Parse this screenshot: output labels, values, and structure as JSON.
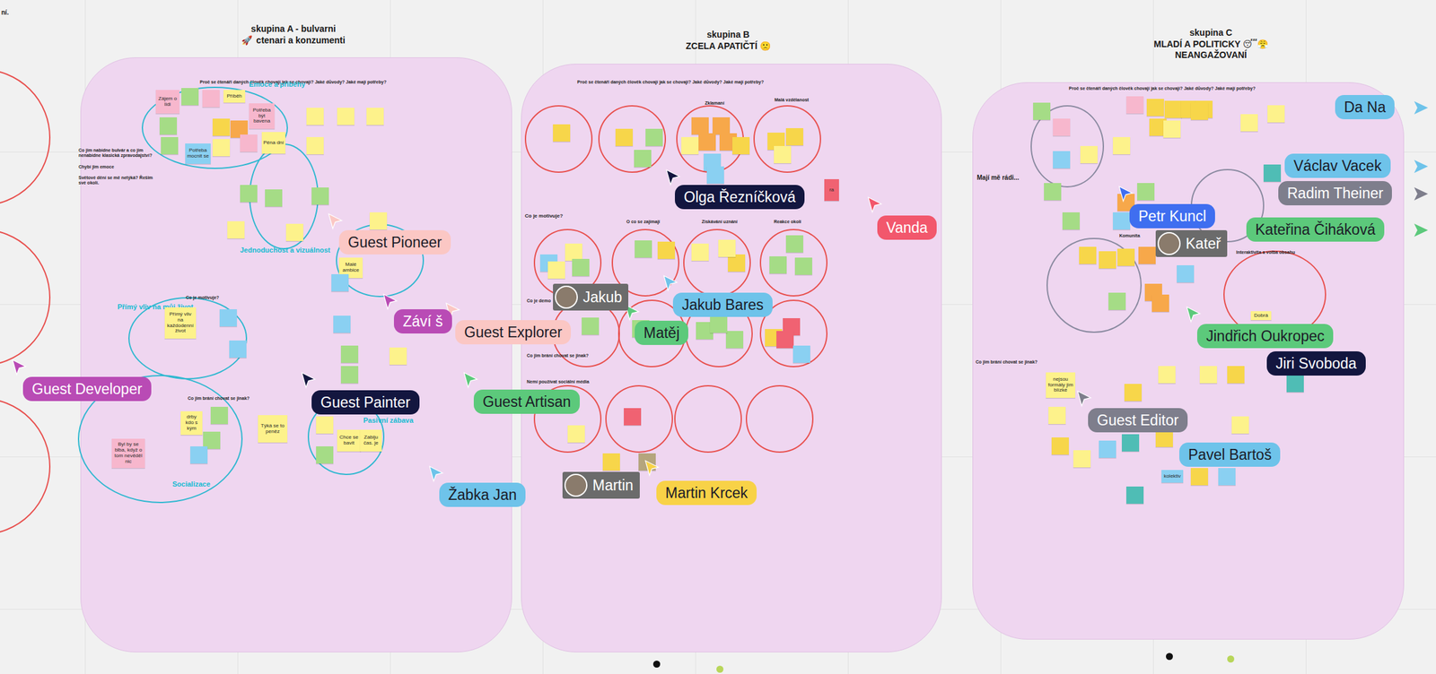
{
  "board_header": "ní.",
  "groups": [
    {
      "icon": "🚀",
      "lines": [
        "skupina A - bulvarni",
        "ctenari a konzumenti"
      ]
    },
    {
      "lines": [
        "skupina B",
        "ZCELA APATIČTÍ 🙁"
      ]
    },
    {
      "lines": [
        "skupina C",
        "MLADÍ A POLITICKY 😴😤",
        "NEANGAŽOVANÍ"
      ]
    }
  ],
  "labels": [
    "Proč se čtenáři daných člověk chovají jak se chovají? Jaké důvody? Jaké mají potřeby?",
    "Co jim nabídne bulvár a co jim nenabídne klasická zpravodajství?",
    "Chybí jim emoce",
    "Světové dění se mě netýká? Řešim své okolí.",
    "Co je motivuje?",
    "Co jim brání chovat se jinak?",
    "Proč se čtenáři daných člověk chovají jak se chovají? Jaké důvody? Jaké mají potřeby?",
    "Zklamaní",
    "Malá vzdělanost",
    "Co je motivuje?",
    "O co se zajímají",
    "Získávání uznání",
    "Reakce okolí",
    "Co je demo",
    "Co jim brání chovat se jinak?",
    "Nemí používat sociální média",
    "Proč se čtenáři daných člověk chovají jak se chovají? Jaké důvody? Jaké mají potřeby?",
    "Mají mě rádi...",
    "Komunita",
    "Interaktivita a volba obsahu",
    "Co jim brání chovat se jinak?"
  ],
  "tags": [
    "Emoce a příběhy",
    "Jednoduchost a vizuálnost",
    "Přímý vliv na můj život",
    "Socializace",
    "Pasivní zábava"
  ],
  "notes": [
    {
      "text": "Zájem o lidi",
      "color": "#f7b7cd"
    },
    {
      "text": "Příběh",
      "color": "#fdf28b"
    },
    {
      "text": "Potřeba být bavena",
      "color": "#f7b7cd"
    },
    {
      "text": "Péna dní",
      "color": "#fdf28b"
    },
    {
      "text": "Potřeba mocnit se",
      "color": "#8ad0f2"
    },
    {
      "text": "Malé ambice",
      "color": "#fdf28b"
    },
    {
      "text": "Přímý vliv na každodenní život",
      "color": "#fdf28b"
    },
    {
      "text": "Týká se to peněz",
      "color": "#fdf28b"
    },
    {
      "text": "Chce se bavit",
      "color": "#fdf28b"
    },
    {
      "text": "Zabiju čas. je",
      "color": "#fdf28b"
    },
    {
      "text": "drby kdo s kým",
      "color": "#fdf28b"
    },
    {
      "text": "Byl by se blba, když o tom nevěděl nic",
      "color": "#f7b7cd"
    },
    {
      "text": "nejsou formáty jim blízké",
      "color": "#fdf28b"
    },
    {
      "text": "Dobrá",
      "color": "#fdf28b"
    },
    {
      "text": "kolektiv",
      "color": "#8ad0f2"
    },
    {
      "text": "ra",
      "color": "#f06272"
    },
    {
      "text": "",
      "color": "#a5dc86"
    },
    {
      "text": "",
      "color": "#f7b7cd"
    },
    {
      "text": "",
      "color": "#f7d64a"
    },
    {
      "text": "",
      "color": "#f7a84a"
    },
    {
      "text": "",
      "color": "#fdf28b"
    },
    {
      "text": "",
      "color": "#f7b7cd"
    },
    {
      "text": "",
      "color": "#a5dc86"
    },
    {
      "text": "",
      "color": "#a5dc86"
    },
    {
      "text": "",
      "color": "#fdf28b"
    },
    {
      "text": "",
      "color": "#fdf28b"
    },
    {
      "text": "",
      "color": "#fdf28b"
    },
    {
      "text": "",
      "color": "#fdf28b"
    },
    {
      "text": "",
      "color": "#a5dc86"
    },
    {
      "text": "",
      "color": "#a5dc86"
    },
    {
      "text": "",
      "color": "#a5dc86"
    },
    {
      "text": "",
      "color": "#8ad0f2"
    },
    {
      "text": "",
      "color": "#8ad0f2"
    },
    {
      "text": "",
      "color": "#a5dc86"
    },
    {
      "text": "",
      "color": "#a5dc86"
    },
    {
      "text": "",
      "color": "#fdf28b"
    },
    {
      "text": "",
      "color": "#8ad0f2"
    },
    {
      "text": "",
      "color": "#8ad0f2"
    },
    {
      "text": "",
      "color": "#a5dc86"
    },
    {
      "text": "",
      "color": "#a5dc86"
    },
    {
      "text": "",
      "color": "#8ad0f2"
    },
    {
      "text": "",
      "color": "#fdf28b"
    },
    {
      "text": "",
      "color": "#a5dc86"
    },
    {
      "text": "",
      "color": "#fdf28b"
    },
    {
      "text": "",
      "color": "#fdf28b"
    },
    {
      "text": "",
      "color": "#fdf28b"
    },
    {
      "text": "",
      "color": "#f7d64a"
    },
    {
      "text": "",
      "color": "#f7d64a"
    },
    {
      "text": "",
      "color": "#a5dc86"
    },
    {
      "text": "",
      "color": "#a5dc86"
    },
    {
      "text": "",
      "color": "#fdf28b"
    },
    {
      "text": "",
      "color": "#f7a84a"
    },
    {
      "text": "",
      "color": "#f7a84a"
    },
    {
      "text": "",
      "color": "#f7a84a"
    },
    {
      "text": "",
      "color": "#f7a84a"
    },
    {
      "text": "",
      "color": "#f7d64a"
    },
    {
      "text": "",
      "color": "#8ad0f2"
    },
    {
      "text": "",
      "color": "#8ad0f2"
    },
    {
      "text": "",
      "color": "#f7d64a"
    },
    {
      "text": "",
      "color": "#f7d64a"
    },
    {
      "text": "",
      "color": "#fdf28b"
    },
    {
      "text": "",
      "color": "#fdf28b"
    },
    {
      "text": "",
      "color": "#8ad0f2"
    },
    {
      "text": "",
      "color": "#fdf28b"
    },
    {
      "text": "",
      "color": "#a5dc86"
    },
    {
      "text": "",
      "color": "#a5dc86"
    },
    {
      "text": "",
      "color": "#f7d64a"
    },
    {
      "text": "",
      "color": "#fdf28b"
    },
    {
      "text": "",
      "color": "#f7d64a"
    },
    {
      "text": "",
      "color": "#fdf28b"
    },
    {
      "text": "",
      "color": "#a5dc86"
    },
    {
      "text": "",
      "color": "#a5dc86"
    },
    {
      "text": "",
      "color": "#a5dc86"
    },
    {
      "text": "",
      "color": "#a5dc86"
    },
    {
      "text": "",
      "color": "#a5dc86"
    },
    {
      "text": "",
      "color": "#a5dc86"
    },
    {
      "text": "",
      "color": "#a5dc86"
    },
    {
      "text": "",
      "color": "#a5dc86"
    },
    {
      "text": "",
      "color": "#f7d64a"
    },
    {
      "text": "",
      "color": "#f06272"
    },
    {
      "text": "",
      "color": "#f06272"
    },
    {
      "text": "",
      "color": "#8ad0f2"
    },
    {
      "text": "",
      "color": "#fdf28b"
    },
    {
      "text": "",
      "color": "#f06272"
    },
    {
      "text": "",
      "color": "#f7d64a"
    },
    {
      "text": "",
      "color": "#b5a57d"
    },
    {
      "text": "",
      "color": "#f7b7cd"
    },
    {
      "text": "",
      "color": "#f7d64a"
    },
    {
      "text": "",
      "color": "#f7d64a"
    },
    {
      "text": "",
      "color": "#f7d64a"
    },
    {
      "text": "",
      "color": "#f7d64a"
    },
    {
      "text": "",
      "color": "#f7d64a"
    },
    {
      "text": "",
      "color": "#fdf28b"
    },
    {
      "text": "",
      "color": "#fdf28b"
    },
    {
      "text": "",
      "color": "#f7a84a"
    },
    {
      "text": "",
      "color": "#a5dc86"
    },
    {
      "text": "",
      "color": "#8ad0f2"
    },
    {
      "text": "",
      "color": "#f7b7cd"
    },
    {
      "text": "",
      "color": "#fdf28b"
    },
    {
      "text": "",
      "color": "#8ad0f2"
    },
    {
      "text": "",
      "color": "#a5dc86"
    },
    {
      "text": "",
      "color": "#a5dc86"
    },
    {
      "text": "",
      "color": "#f7d64a"
    },
    {
      "text": "",
      "color": "#f7d64a"
    },
    {
      "text": "",
      "color": "#f7d64a"
    },
    {
      "text": "",
      "color": "#f7a84a"
    },
    {
      "text": "",
      "color": "#a5dc86"
    },
    {
      "text": "",
      "color": "#f7a84a"
    },
    {
      "text": "",
      "color": "#8ad0f2"
    },
    {
      "text": "",
      "color": "#f7a84a"
    },
    {
      "text": "",
      "color": "#fdf28b"
    },
    {
      "text": "",
      "color": "#fdf28b"
    },
    {
      "text": "",
      "color": "#f7d64a"
    },
    {
      "text": "",
      "color": "#4fbdb5"
    },
    {
      "text": "",
      "color": "#4fbdb5"
    },
    {
      "text": "",
      "color": "#f7d64a"
    },
    {
      "text": "",
      "color": "#fdf28b"
    },
    {
      "text": "",
      "color": "#fdf28b"
    },
    {
      "text": "",
      "color": "#f7d64a"
    },
    {
      "text": "",
      "color": "#fdf28b"
    },
    {
      "text": "",
      "color": "#f7d64a"
    },
    {
      "text": "",
      "color": "#fdf28b"
    },
    {
      "text": "",
      "color": "#8ad0f2"
    },
    {
      "text": "",
      "color": "#4fbdb5"
    },
    {
      "text": "",
      "color": "#f7d64a"
    },
    {
      "text": "",
      "color": "#f7d64a"
    },
    {
      "text": "",
      "color": "#8ad0f2"
    },
    {
      "text": "",
      "color": "#4fbdb5"
    },
    {
      "text": "",
      "color": "#fdf28b"
    },
    {
      "text": "",
      "color": "#a5dc86"
    }
  ],
  "cursors": [
    {
      "name": "Olga Řezníčková",
      "color": "#13163f",
      "kind": "pointer"
    },
    {
      "name": "Vanda",
      "color": "#f2576c",
      "kind": "pointer"
    },
    {
      "name": "Guest Pioneer",
      "color": "#fbc7c4",
      "kind": "pointer"
    },
    {
      "name": "Záví š",
      "color": "#b94bb5",
      "kind": "pointer"
    },
    {
      "name": "Guest Explorer",
      "color": "#fbc7c4",
      "kind": "pointer"
    },
    {
      "name": "Jakub",
      "color": "#6b6b6b",
      "kind": "avatar"
    },
    {
      "name": "Jakub Bares",
      "color": "#6ec3ea",
      "kind": "pointer"
    },
    {
      "name": "Matěj",
      "color": "#5cc97b",
      "kind": "pointer"
    },
    {
      "name": "Guest Developer",
      "color": "#b94bb5",
      "kind": "pointer"
    },
    {
      "name": "Guest Painter",
      "color": "#13163f",
      "kind": "pointer"
    },
    {
      "name": "Guest Artisan",
      "color": "#5cc97b",
      "kind": "pointer"
    },
    {
      "name": "Žabka Jan",
      "color": "#6ec3ea",
      "kind": "pointer"
    },
    {
      "name": "Martin",
      "color": "#6b6b6b",
      "kind": "avatar"
    },
    {
      "name": "Martin Krcek",
      "color": "#f8d247",
      "kind": "pointer"
    },
    {
      "name": "Da Na",
      "color": "#6ec3ea",
      "kind": "offscreen"
    },
    {
      "name": "Václav Vacek",
      "color": "#6ec3ea",
      "kind": "offscreen"
    },
    {
      "name": "Radim Theiner",
      "color": "#7e7e8c",
      "kind": "offscreen"
    },
    {
      "name": "Petr Kuncl",
      "color": "#3f6ef0",
      "kind": "pointer"
    },
    {
      "name": "Kateř",
      "color": "#6b6b6b",
      "kind": "avatar"
    },
    {
      "name": "Kateřina Čiháková",
      "color": "#5cc97b",
      "kind": "offscreen"
    },
    {
      "name": "Jindřich Oukropec",
      "color": "#5cc97b",
      "kind": "pointer"
    },
    {
      "name": "Jiri Svoboda",
      "color": "#13163f",
      "kind": "label"
    },
    {
      "name": "Guest Editor",
      "color": "#7e7e8c",
      "kind": "pointer"
    },
    {
      "name": "Pavel Bartoš",
      "color": "#6ec3ea",
      "kind": "label"
    }
  ]
}
